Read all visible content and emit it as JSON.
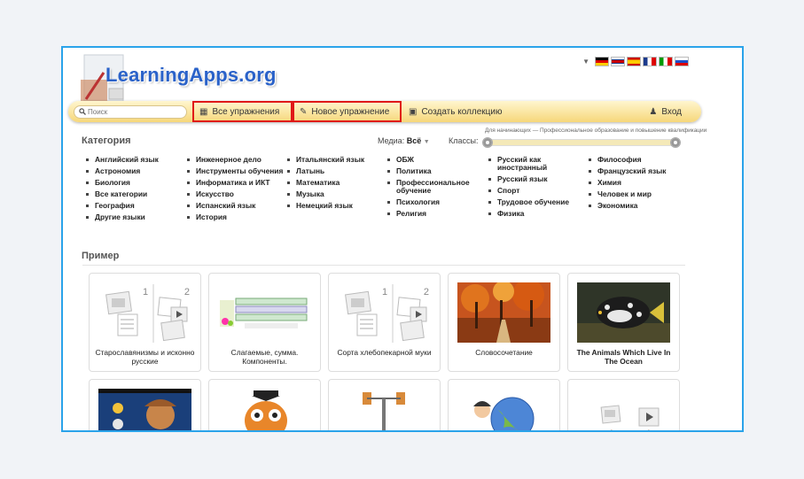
{
  "logo": {
    "text": "LearningApps.org"
  },
  "languages": [
    "de",
    "en",
    "es",
    "fr",
    "it",
    "ru"
  ],
  "nav": {
    "search_placeholder": "Поиск",
    "all_exercises": "Все упражнения",
    "new_exercise": "Новое упражнение",
    "create_collection": "Создать коллекцию",
    "login": "Вход"
  },
  "filters": {
    "category_title": "Категория",
    "media_label": "Медиа:",
    "media_value": "Всё",
    "classes_label": "Классы:",
    "slider_range": "Для начинающих — Профессиональное образование и повышение квалификации",
    "slider_min": 0,
    "slider_max": 1
  },
  "categories": [
    [
      "Английский язык",
      "Астрономия",
      "Биология",
      "Все категории",
      "География",
      "Другие языки"
    ],
    [
      "Инженерное дело",
      "Инструменты обучения",
      "Информатика и ИКТ",
      "Искусство",
      "Испанский язык",
      "История"
    ],
    [
      "Итальянский язык",
      "Латынь",
      "Математика",
      "Музыка",
      "Немецкий язык"
    ],
    [
      "ОБЖ",
      "Политика",
      "Профессиональное обучение",
      "Психология",
      "Религия"
    ],
    [
      "Русский как иностранный",
      "Русский язык",
      "Спорт",
      "Трудовое обучение",
      "Физика"
    ],
    [
      "Философия",
      "Французский язык",
      "Химия",
      "Человек и мир",
      "Экономика"
    ]
  ],
  "examples": {
    "title": "Пример",
    "cards": [
      {
        "caption": "Старославянизмы и исконно русские",
        "bold": false
      },
      {
        "caption": "Слагаемые, сумма. Компоненты.",
        "bold": false
      },
      {
        "caption": "Сорта хлебопекарной муки",
        "bold": false
      },
      {
        "caption": "Словосочетание",
        "bold": false
      },
      {
        "caption": "The Animals Which Live In The Ocean",
        "bold": true
      }
    ]
  },
  "colors": {
    "accent": "#2aa3ea",
    "highlight": "#e01818",
    "nav_bg": "#f6d77a",
    "logo": "#2a62c9"
  }
}
